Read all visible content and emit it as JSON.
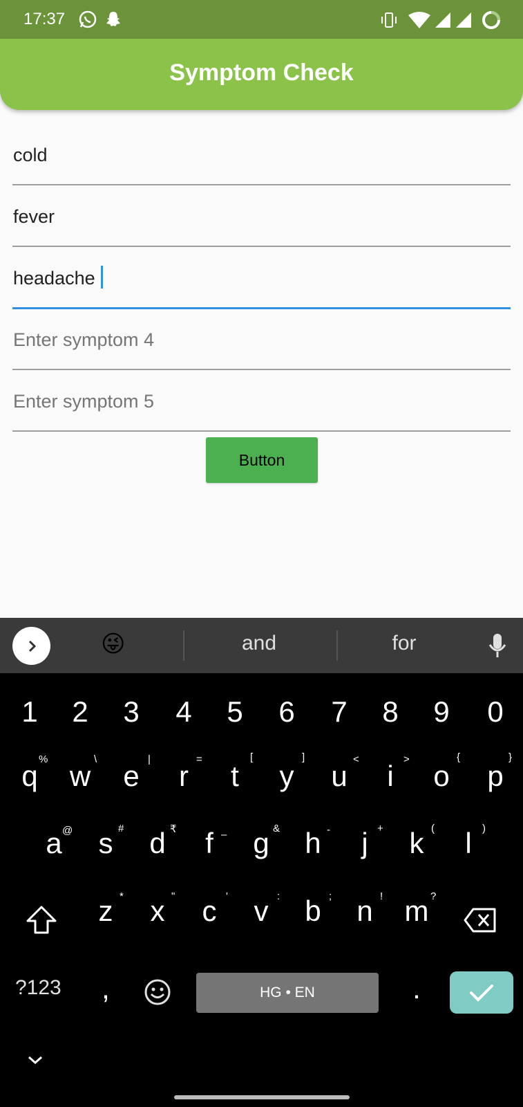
{
  "status_bar": {
    "time": "17:37"
  },
  "app_bar": {
    "title": "Symptom Check"
  },
  "form": {
    "fields": [
      {
        "value": "cold",
        "placeholder": ""
      },
      {
        "value": "fever",
        "placeholder": ""
      },
      {
        "value": "headache",
        "placeholder": ""
      },
      {
        "value": "",
        "placeholder": "Enter symptom 4"
      },
      {
        "value": "",
        "placeholder": "Enter symptom 5"
      }
    ],
    "button_label": "Button"
  },
  "keyboard": {
    "suggestions": [
      "and",
      "for"
    ],
    "emoji_suggestion": "😜",
    "number_row": [
      "1",
      "2",
      "3",
      "4",
      "5",
      "6",
      "7",
      "8",
      "9",
      "0"
    ],
    "row1": [
      "q",
      "w",
      "e",
      "r",
      "t",
      "y",
      "u",
      "i",
      "o",
      "p"
    ],
    "row1_hints": [
      "%",
      "\\",
      "|",
      "=",
      "[",
      "]",
      "<",
      ">",
      "{",
      "}"
    ],
    "row2": [
      "a",
      "s",
      "d",
      "f",
      "g",
      "h",
      "j",
      "k",
      "l"
    ],
    "row2_hints": [
      "@",
      "#",
      "₹",
      "–",
      "&",
      "-",
      "+",
      "(",
      ")"
    ],
    "row3": [
      "z",
      "x",
      "c",
      "v",
      "b",
      "n",
      "m"
    ],
    "row3_hints": [
      "*",
      "\"",
      "'",
      ":",
      ";",
      "!",
      "?"
    ],
    "symbols_label": "?123",
    "comma": ",",
    "space_label": "HG • EN",
    "period": "."
  },
  "colors": {
    "status_bar": "#6b933a",
    "app_bar": "#8bc34a",
    "button": "#4caf50",
    "focus_underline": "#2f8fe0",
    "enter_key": "#80cbc4"
  }
}
